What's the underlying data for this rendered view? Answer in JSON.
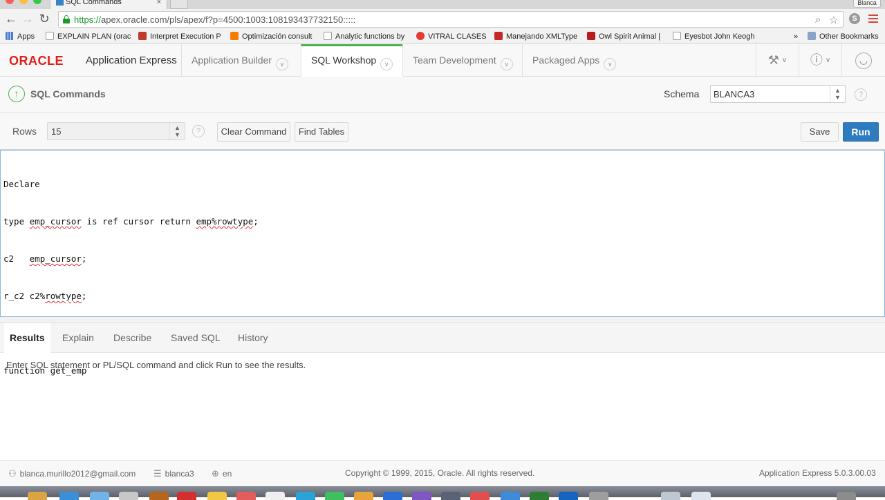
{
  "browser": {
    "tab_title": "SQL Commands",
    "tab_close": "×",
    "profile": "Blanca",
    "url_https": "https://",
    "url_rest": "apex.oracle.com/pls/apex/f?p=4500:1003:108193437732150:::::",
    "bookmarks": [
      {
        "label": "Apps",
        "color": "#4b7bd6"
      },
      {
        "label": "EXPLAIN PLAN (orac",
        "color": "#cfcfcf"
      },
      {
        "label": "Interpret Execution P",
        "color": "#c0392b"
      },
      {
        "label": "Optimización consult",
        "color": "#f57c00"
      },
      {
        "label": "Analytic functions by",
        "color": "#cfcfcf"
      },
      {
        "label": "VITRAL CLASES",
        "color": "#e53935"
      },
      {
        "label": "Manejando XMLType",
        "color": "#c62828"
      },
      {
        "label": "Owl Spirit Animal |",
        "color": "#b71c1c"
      },
      {
        "label": "Eyesbot John Keogh",
        "color": "#cfcfcf"
      }
    ],
    "bookmarks_more": "»",
    "other_bookmarks": "Other Bookmarks"
  },
  "header": {
    "logo": "ORACLE",
    "app_name": "Application Express",
    "tabs": [
      {
        "label": "Application Builder"
      },
      {
        "label": "SQL Workshop"
      },
      {
        "label": "Team Development"
      },
      {
        "label": "Packaged Apps"
      }
    ],
    "chevron": "∨"
  },
  "page": {
    "title": "SQL Commands",
    "schema_label": "Schema",
    "schema_value": "BLANCA3",
    "help": "?"
  },
  "controls": {
    "rows_label": "Rows",
    "rows_value": "15",
    "clear_command": "Clear Command",
    "find_tables": "Find Tables",
    "save": "Save",
    "run": "Run"
  },
  "editor": {
    "lines": [
      "Declare",
      "type emp_cursor is ref cursor return emp%rowtype;",
      "c2   emp_cursor;",
      "r_c2 c2%rowtype;",
      "",
      "function get_emp"
    ]
  },
  "results": {
    "tabs": [
      "Results",
      "Explain",
      "Describe",
      "Saved SQL",
      "History"
    ],
    "active_tab": "Results",
    "message": "Enter SQL statement or PL/SQL command and click Run to see the results."
  },
  "footer": {
    "user": "blanca.murillo2012@gmail.com",
    "workspace": "blanca3",
    "language": "en",
    "copyright": "Copyright © 1999, 2015, Oracle. All rights reserved.",
    "version": "Application Express 5.0.3.00.03"
  }
}
